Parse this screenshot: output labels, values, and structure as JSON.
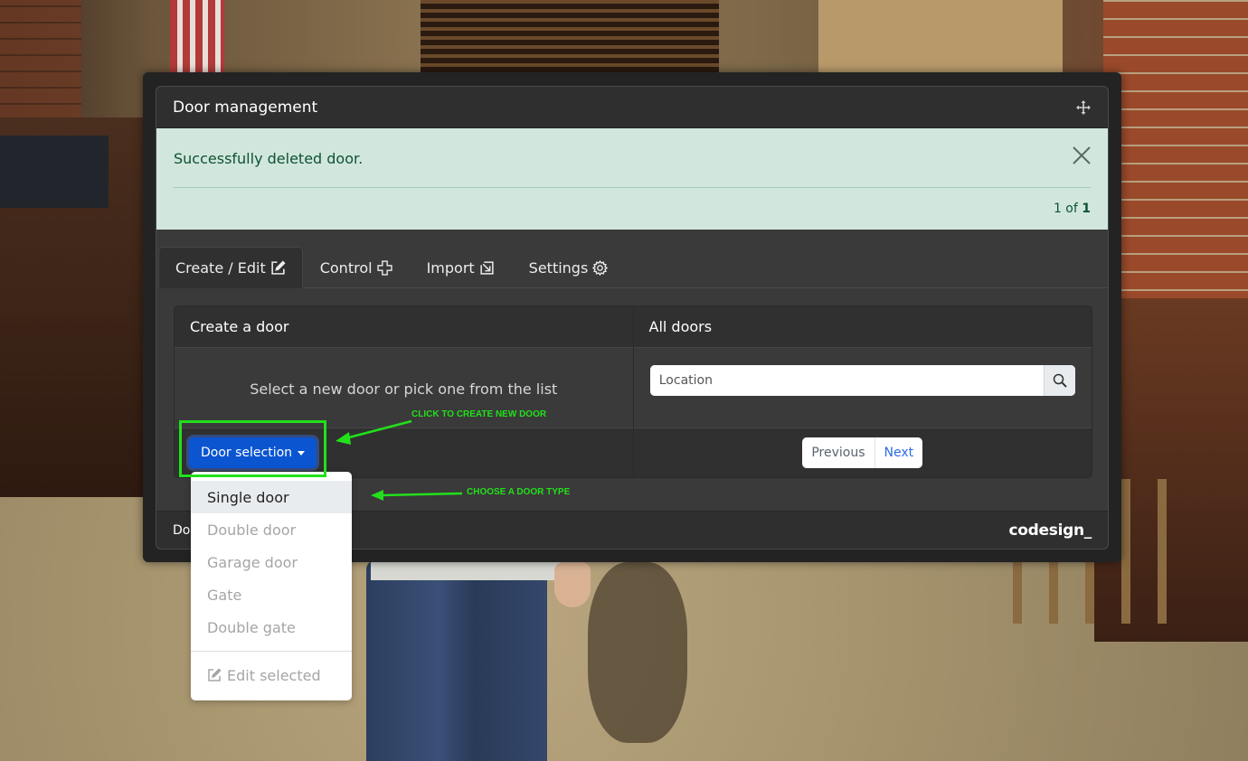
{
  "window": {
    "title": "Door management",
    "move_icon": "move-arrows-icon"
  },
  "alert": {
    "message": "Successfully deleted door.",
    "counter_prefix": "1 of ",
    "counter_total": "1",
    "close_icon": "close-x-icon",
    "bg_color": "#d1e7dd",
    "text_color": "#0f5132"
  },
  "tabs": [
    {
      "label": "Create / Edit",
      "icon": "edit-icon",
      "active": true
    },
    {
      "label": "Control",
      "icon": "dpad-icon",
      "active": false
    },
    {
      "label": "Import",
      "icon": "import-icon",
      "active": false
    },
    {
      "label": "Settings",
      "icon": "gear-icon",
      "active": false
    }
  ],
  "create_panel": {
    "title": "Create a door",
    "hint": "Select a new door or pick one from the list",
    "button_label": "Door selection",
    "button_color": "#0b55d0"
  },
  "doors_panel": {
    "title": "All doors",
    "search_placeholder": "Location",
    "search_icon": "search-icon",
    "prev_label": "Previous",
    "next_label": "Next"
  },
  "dropdown": {
    "items": [
      {
        "label": "Single door",
        "active": true
      },
      {
        "label": "Double door",
        "active": false
      },
      {
        "label": "Garage door",
        "active": false
      },
      {
        "label": "Gate",
        "active": false
      },
      {
        "label": "Double gate",
        "active": false
      }
    ],
    "edit_label": "Edit selected",
    "edit_icon": "edit-icon"
  },
  "footer": {
    "text_visible": "Do",
    "brand": "codesign_"
  },
  "annotations": {
    "click_hint": "CLICK TO CREATE NEW DOOR",
    "choose_hint": "CHOOSE A DOOR TYPE",
    "color": "#22e01b"
  }
}
